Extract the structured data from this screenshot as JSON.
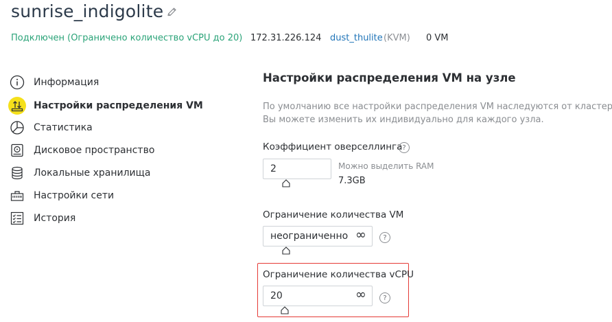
{
  "header": {
    "title": "sunrise_indigolite",
    "status": "Подключен (Ограничено количество vCPU до 20)",
    "ip": "172.31.226.124",
    "cluster_name": "dust_thulite",
    "cluster_type": "(KVM)",
    "vm_count": "0 VM"
  },
  "sidebar": {
    "items": [
      {
        "label": "Информация",
        "icon": "info-icon"
      },
      {
        "label": "Настройки распределения VM",
        "icon": "vm-distribution-icon",
        "active": true
      },
      {
        "label": "Статистика",
        "icon": "pie-chart-icon"
      },
      {
        "label": "Дисковое пространство",
        "icon": "disk-icon"
      },
      {
        "label": "Локальные хранилища",
        "icon": "database-icon"
      },
      {
        "label": "Настройки сети",
        "icon": "network-icon"
      },
      {
        "label": "История",
        "icon": "history-icon"
      }
    ]
  },
  "main": {
    "title": "Настройки распределения VM на узле",
    "description_line1": "По умолчанию все настройки распределения VM наследуются от кластера.",
    "description_line2": "Вы можете изменить их индивидуально для каждого узла.",
    "overcommit": {
      "label": "Коэффициент оверселлинга",
      "value": "2",
      "hint_label": "Можно выделить RAM",
      "hint_value": "7.3GB"
    },
    "vm_limit": {
      "label": "Ограничение количества VM",
      "value": "неограниченно",
      "infinity_symbol": "∞"
    },
    "vcpu_limit": {
      "label": "Ограничение количества vCPU",
      "value": "20",
      "infinity_symbol": "∞"
    }
  },
  "colors": {
    "status_green": "#2aa378",
    "link_blue": "#1f74b8",
    "active_icon_bg": "#f5e01b",
    "highlight_red": "#e53935"
  }
}
